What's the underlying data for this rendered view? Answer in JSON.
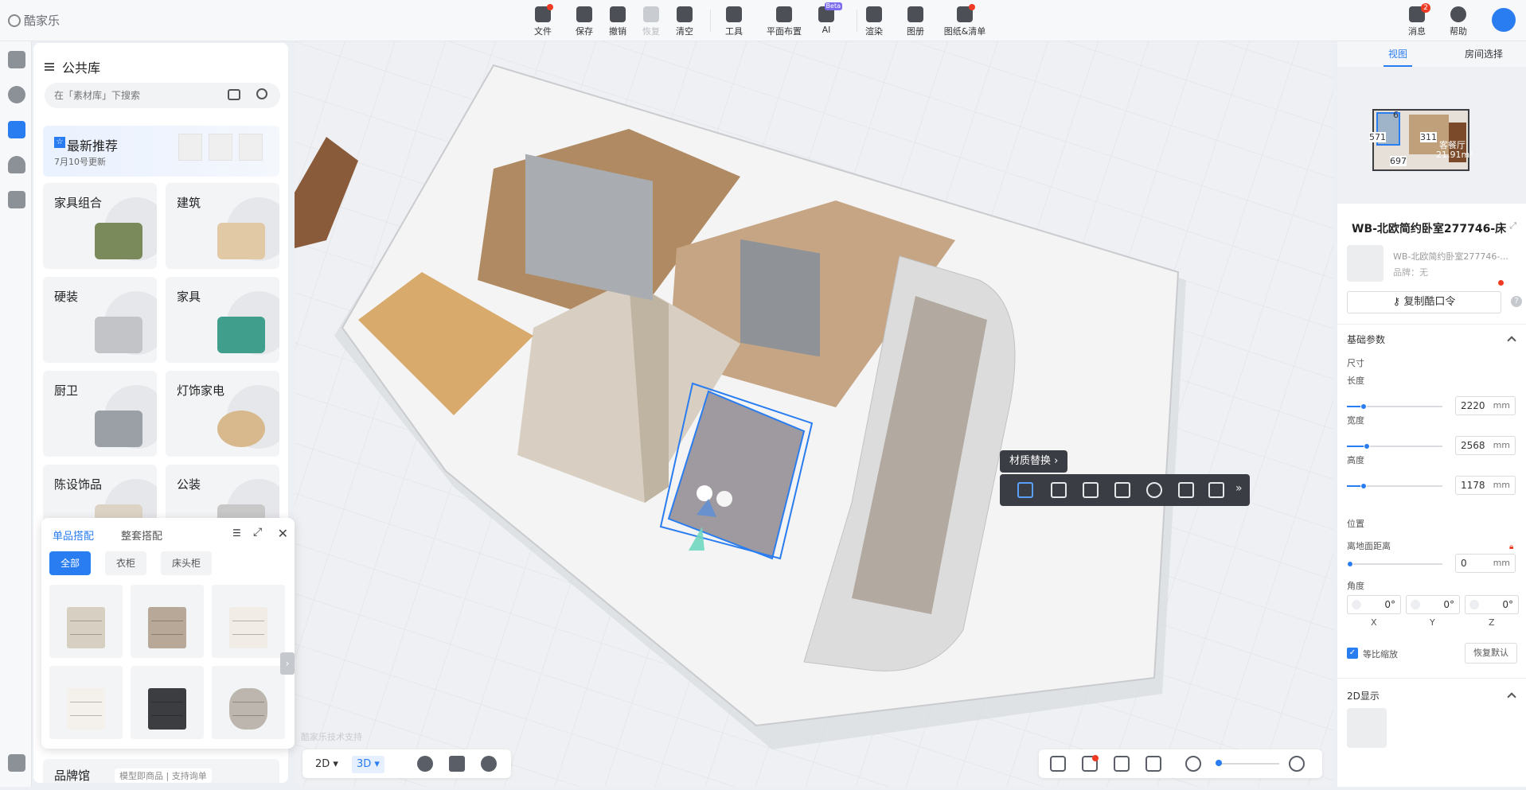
{
  "app": {
    "logo": "酷家乐"
  },
  "toolbar": {
    "items": [
      {
        "label": "文件"
      },
      {
        "label": "保存"
      },
      {
        "label": "撤销"
      },
      {
        "label": "恢复"
      },
      {
        "label": "清空"
      },
      {
        "label": "工具"
      },
      {
        "label": "平面布置"
      },
      {
        "label": "AI"
      },
      {
        "label": "渲染"
      },
      {
        "label": "图册"
      },
      {
        "label": "图纸&清单"
      }
    ],
    "ai_badge": "Beta",
    "right": [
      {
        "label": "消息",
        "count": "2"
      },
      {
        "label": "帮助"
      }
    ]
  },
  "library": {
    "title": "公共库",
    "search_placeholder": "在「素材库」下搜索",
    "recommend": {
      "title": "最新推荐",
      "subtitle": "7月10号更新"
    },
    "categories": [
      "家具组合",
      "建筑",
      "硬装",
      "家具",
      "厨卫",
      "灯饰家电",
      "陈设饰品",
      "公装"
    ],
    "brand": {
      "title": "品牌馆",
      "tag": "模型即商品 | 支持询单"
    }
  },
  "match_panel": {
    "tabs": [
      "单品搭配",
      "整套搭配"
    ],
    "chips": [
      "全部",
      "衣柜",
      "床头柜"
    ]
  },
  "scene": {
    "tip": "材质替换",
    "watermark": "酷家乐技术支持"
  },
  "viewbar": {
    "mode_2d": "2D",
    "mode_3d": "3D"
  },
  "right_panel": {
    "tabs": [
      "视图",
      "房间选择"
    ],
    "minimap": {
      "room_name": "客餐厅",
      "room_area": "21.91m²",
      "dims": [
        "6",
        "571",
        "311",
        "697"
      ]
    },
    "title": "WB-北欧简约卧室277746-床",
    "model_name": "WB-北欧简约卧室277746-...",
    "model_brand": "品牌：无",
    "copy_button": "复制酷口令",
    "section_basic": "基础参数",
    "size_label": "尺寸",
    "length_label": "长度",
    "length_value": "2220",
    "width_label": "宽度",
    "width_value": "2568",
    "height_label": "高度",
    "height_value": "1178",
    "unit": "mm",
    "position_label": "位置",
    "ground_label": "离地面距离",
    "ground_value": "0",
    "angle_label": "角度",
    "angle_x": "0°",
    "angle_y": "0°",
    "angle_z": "0°",
    "axis_x": "X",
    "axis_y": "Y",
    "axis_z": "Z",
    "scale_label": "等比缩放",
    "reset_button": "恢复默认",
    "section_2d": "2D显示"
  },
  "colors": {
    "accent": "#2a7df0",
    "alert": "#f03b24"
  }
}
